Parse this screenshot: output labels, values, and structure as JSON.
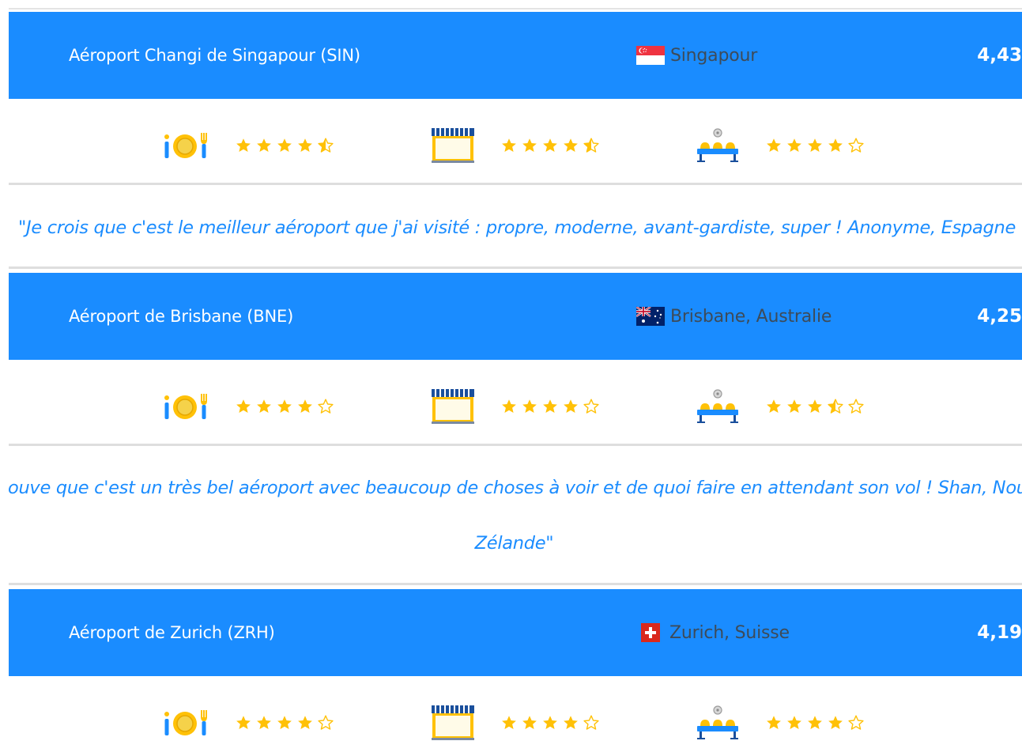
{
  "airports": [
    {
      "name": "Aéroport Changi de Singapour (SIN)",
      "location": "Singapour",
      "flag": "singapore-flag",
      "score": "4,43",
      "ratings": {
        "food": 4.5,
        "shops": 4.5,
        "seating": 4
      },
      "quote": [
        "\"Je crois que c'est le meilleur aéroport que j'ai visité : propre, moderne, avant-gardiste, super ! Anonyme, Espagne \""
      ]
    },
    {
      "name": "Aéroport de Brisbane (BNE)",
      "location": "Brisbane, Australie",
      "flag": "australia-flag",
      "score": "4,25",
      "ratings": {
        "food": 4,
        "shops": 4,
        "seating": 3.5
      },
      "quote": [
        "ouve que c'est un très bel aéroport avec beaucoup de choses à voir et de quoi faire en attendant son vol ! Shan, Nouv",
        "Zélande\""
      ]
    },
    {
      "name": "Aéroport de Zurich (ZRH)",
      "location": "Zurich, Suisse",
      "flag": "switzerland-flag",
      "score": "4,19",
      "ratings": {
        "food": 4,
        "shops": 4,
        "seating": 4
      }
    }
  ],
  "colors": {
    "header": "#1a8cff",
    "star": "#ffc107",
    "quote": "#1a8cff"
  },
  "icons": {
    "food": "dining-icon",
    "shops": "shop-icon",
    "seating": "seating-icon"
  }
}
